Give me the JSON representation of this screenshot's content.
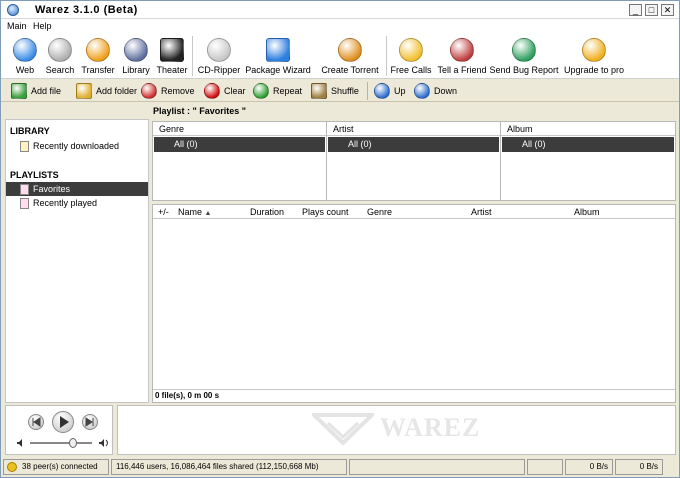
{
  "app": {
    "title": "Warez 3.1.0 (Beta)"
  },
  "window_controls": {
    "minimize": "_",
    "maximize": "□",
    "close": "✕"
  },
  "menu": [
    "Main",
    "Help"
  ],
  "toolbar": [
    {
      "label": "Web",
      "icon": "globe-icon",
      "color": "#3d8ee6"
    },
    {
      "label": "Search",
      "icon": "magnifier-icon",
      "color": "#b0b0b0"
    },
    {
      "label": "Transfer",
      "icon": "transfer-diamond-icon",
      "color": "#f0a020"
    },
    {
      "label": "Library",
      "icon": "books-icon",
      "color": "#6070a0"
    },
    {
      "label": "Theater",
      "icon": "film-icon",
      "color": "#222222"
    },
    {
      "label": "CD-Ripper",
      "icon": "cd-icon",
      "color": "#c8c8c8"
    },
    {
      "label": "Package Wizard",
      "icon": "package-grid-icon",
      "color": "#2f7fe0"
    },
    {
      "label": "Create Torrent",
      "icon": "magic-wand-icon",
      "color": "#e09020"
    },
    {
      "label": "Free Calls",
      "icon": "phone-icon",
      "color": "#f2c030"
    },
    {
      "label": "Tell a Friend",
      "icon": "people-icon",
      "color": "#c04040"
    },
    {
      "label": "Send Bug Report",
      "icon": "bug-icon",
      "color": "#30a060"
    },
    {
      "label": "Upgrade to pro",
      "icon": "unlock-icon",
      "color": "#f0b020"
    }
  ],
  "actions": [
    {
      "label": "Add file",
      "icon": "add-file-icon",
      "color": "#3aa03a"
    },
    {
      "label": "Add folder",
      "icon": "add-folder-icon",
      "color": "#e0b030"
    },
    {
      "label": "Remove",
      "icon": "remove-icon",
      "color": "#d03030"
    },
    {
      "label": "Clear",
      "icon": "clear-icon",
      "color": "#d01010"
    },
    {
      "label": "Repeat",
      "icon": "repeat-icon",
      "color": "#30a030"
    },
    {
      "label": "Shuffle",
      "icon": "shuffle-icon",
      "color": "#a08040"
    },
    {
      "label": "Up",
      "icon": "arrow-up-icon",
      "color": "#3070d0"
    },
    {
      "label": "Down",
      "icon": "arrow-down-icon",
      "color": "#3070d0"
    }
  ],
  "sidebar": {
    "library_header": "LIBRARY",
    "library_items": [
      {
        "label": "Recently downloaded"
      }
    ],
    "playlists_header": "PLAYLISTS",
    "playlist_items": [
      {
        "label": "Favorites",
        "selected": true
      },
      {
        "label": "Recently played",
        "selected": false
      }
    ]
  },
  "playlist": {
    "title": "Playlist : \" Favorites \""
  },
  "filters": [
    {
      "header": "Genre",
      "all": "All (0)"
    },
    {
      "header": "Artist",
      "all": "All (0)"
    },
    {
      "header": "Album",
      "all": "All (0)"
    }
  ],
  "tracks": {
    "columns": [
      "+/-",
      "Name",
      "Duration",
      "Plays count",
      "Genre",
      "Artist",
      "Album"
    ],
    "sort_indicator": "▲",
    "rows": [],
    "summary": "0 file(s), 0 m 00 s"
  },
  "player": {
    "volume": 0.7
  },
  "visualizer": {
    "logo": "WAREZ"
  },
  "status": {
    "peers": "38 peer(s) connected",
    "network": "116,446 users, 16,086,464 files shared (112,150,668 Mb)",
    "down_rate": "0 B/s",
    "up_rate": "0 B/s"
  },
  "colors": {
    "selection": "#3c3c3c",
    "accent": "#3d8ee6",
    "window_bg": "#ece9d8"
  }
}
